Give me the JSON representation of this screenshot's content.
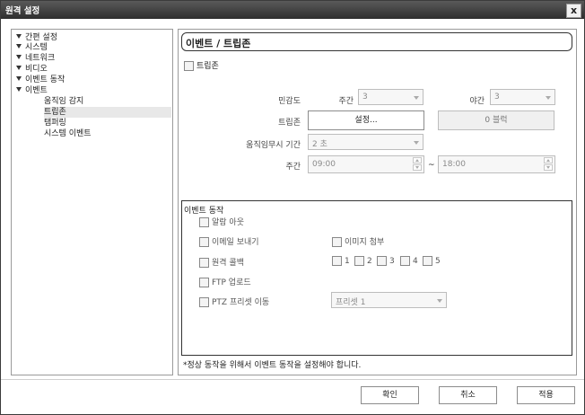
{
  "window": {
    "title": "원격 설정",
    "close_glyph": "x"
  },
  "tree": {
    "items": [
      {
        "label": "간편 설정",
        "expanded": true
      },
      {
        "label": "시스템",
        "expanded": true
      },
      {
        "label": "네트워크",
        "expanded": true
      },
      {
        "label": "비디오",
        "expanded": true
      },
      {
        "label": "이벤트 동작",
        "expanded": true
      },
      {
        "label": "이벤트",
        "expanded": true
      }
    ],
    "children": [
      {
        "label": "움직임 감지",
        "selected": false
      },
      {
        "label": "트립존",
        "selected": true
      },
      {
        "label": "탬퍼링",
        "selected": false
      },
      {
        "label": "시스템 이벤트",
        "selected": false
      }
    ]
  },
  "panel": {
    "heading": "이벤트 / 트립존",
    "tripzone_checkbox": "트립존",
    "sensitivity": {
      "label": "민감도",
      "day_label": "주간",
      "day_value": "3",
      "night_label": "야간",
      "night_value": "3"
    },
    "tripzone": {
      "label": "트립존",
      "setup_button": "설정...",
      "block_value": "0 블럭"
    },
    "ignore": {
      "label": "움직임무시 기간",
      "value": "2 초"
    },
    "daytime": {
      "label": "주간",
      "start": "09:00",
      "separator": "~",
      "end": "18:00"
    },
    "event_actions": {
      "title": "이벤트 동작",
      "alarm_out": "알람 아웃",
      "send_email": "이메일 보내기",
      "attach_image": "이미지 첨부",
      "remote_callback": "원격 콜백",
      "callback_channels": [
        "1",
        "2",
        "3",
        "4",
        "5"
      ],
      "ftp_upload": "FTP 업로드",
      "ptz_preset": "PTZ 프리셋 이동",
      "preset_value": "프리셋 1"
    },
    "note": "*정상 동작을 위해서 이벤트 동작을 설정해야 합니다."
  },
  "buttons": {
    "ok": "확인",
    "cancel": "취소",
    "apply": "적용"
  }
}
